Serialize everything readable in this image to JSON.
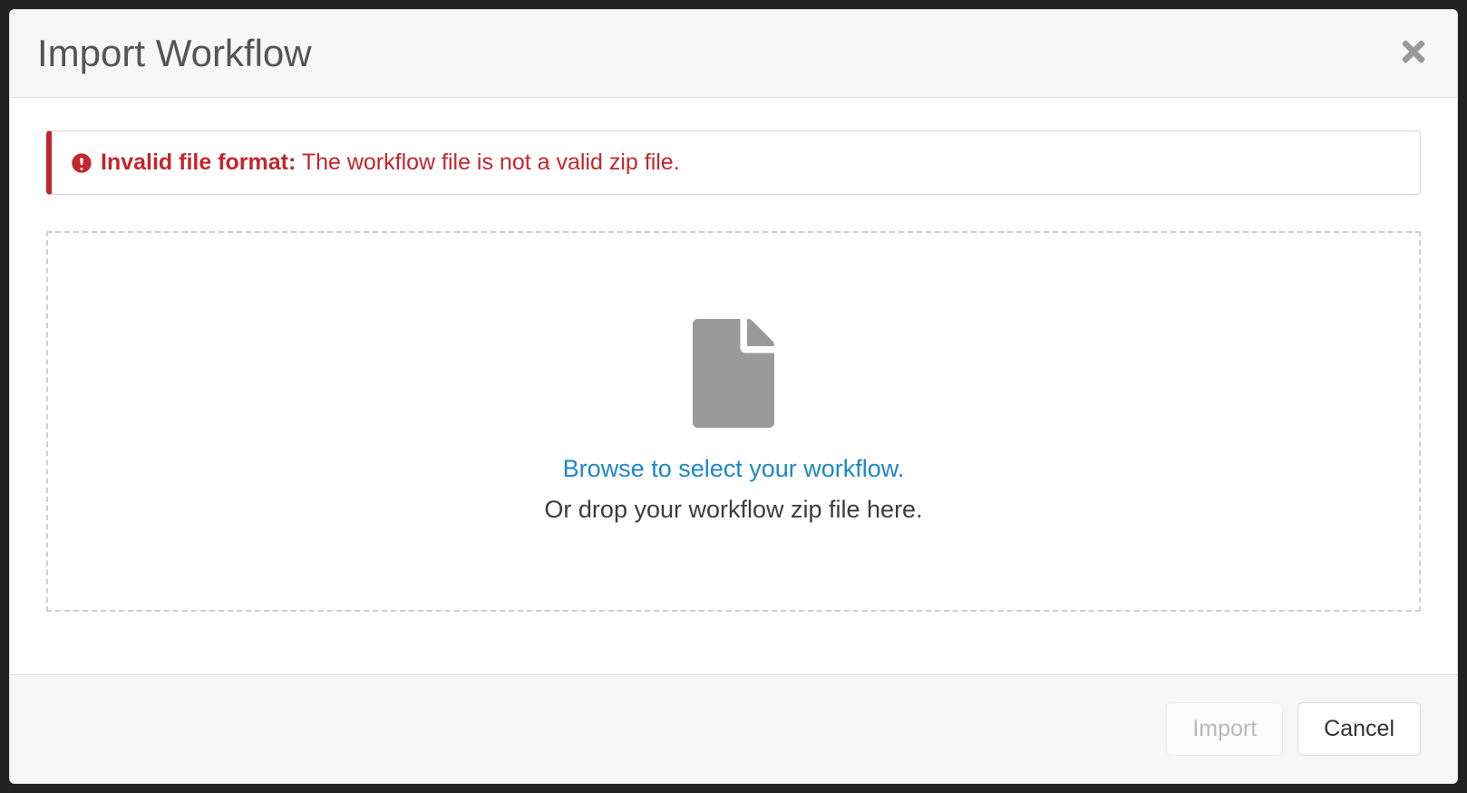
{
  "header": {
    "title": "Import Workflow"
  },
  "alert": {
    "title": "Invalid file format:",
    "message": "The workflow file is not a valid zip file."
  },
  "dropzone": {
    "browse_text": "Browse to select your workflow.",
    "drop_text": "Or drop your workflow zip file here."
  },
  "footer": {
    "import_label": "Import",
    "cancel_label": "Cancel"
  }
}
